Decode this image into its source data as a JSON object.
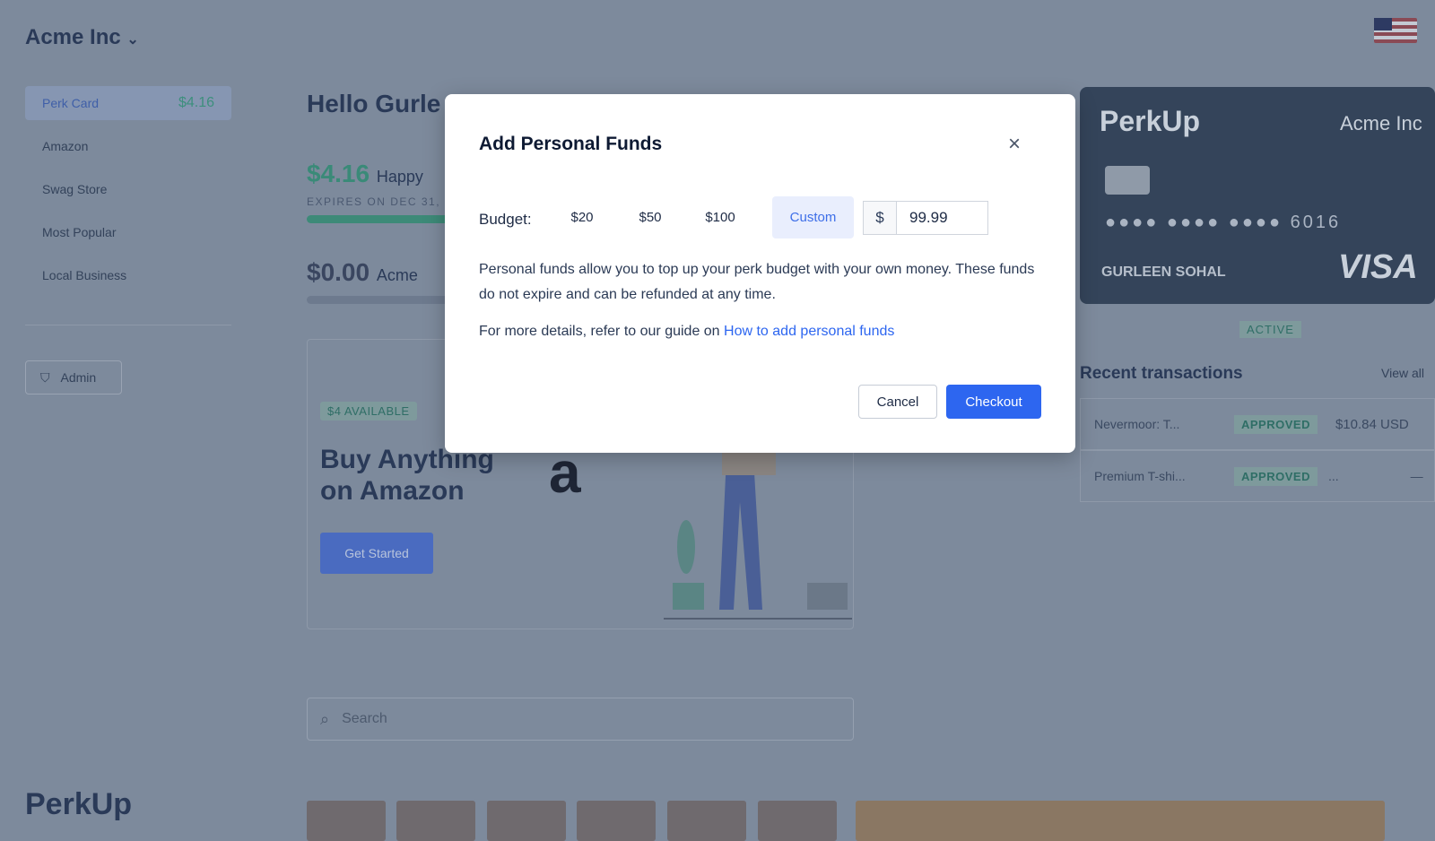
{
  "header": {
    "company": "Acme Inc"
  },
  "sidebar": {
    "items": [
      {
        "label": "Perk Card",
        "amount": "$4.16"
      },
      {
        "label": "Amazon"
      },
      {
        "label": "Swag Store"
      },
      {
        "label": "Most Popular"
      },
      {
        "label": "Local Business"
      }
    ],
    "admin": "Admin"
  },
  "main": {
    "greeting": "Hello Gurle",
    "balance": "$4.16",
    "balance_label": "Happy",
    "expires": "EXPIRES ON DEC 31, 20",
    "balance2": "$0.00",
    "balance2_label": "Acme",
    "available": "$4 AVAILABLE",
    "promo_title": "Buy Anything on Amazon",
    "get_started": "Get Started",
    "amazon_logo": "a",
    "search_placeholder": "Search",
    "logo": "PerkUp"
  },
  "card": {
    "brand": "PerkUp",
    "company": "Acme Inc",
    "number": "●●●● ●●●● ●●●● 6016",
    "name": "GURLEEN SOHAL",
    "network": "VISA",
    "status": "ACTIVE"
  },
  "transactions": {
    "title": "Recent transactions",
    "view_all": "View all",
    "rows": [
      {
        "name": "Nevermoor: T...",
        "status": "APPROVED",
        "amount": "$10.84 USD"
      },
      {
        "name": "Premium T-shi...",
        "status": "APPROVED",
        "extra": "...",
        "amount": "—"
      }
    ]
  },
  "modal": {
    "title": "Add Personal Funds",
    "budget_label": "Budget:",
    "options": [
      "$20",
      "$50",
      "$100",
      "Custom"
    ],
    "selected": "Custom",
    "currency": "$",
    "amount": "99.99",
    "description": "Personal funds allow you to top up your perk budget with your own money. These funds do not expire and can be refunded at any time.",
    "details_prefix": "For more details, refer to our guide on ",
    "details_link": "How to add personal funds",
    "cancel": "Cancel",
    "checkout": "Checkout"
  },
  "colors": {
    "accent": "#2d66f0",
    "success": "#2fa27a",
    "card": "#1e2b45"
  }
}
